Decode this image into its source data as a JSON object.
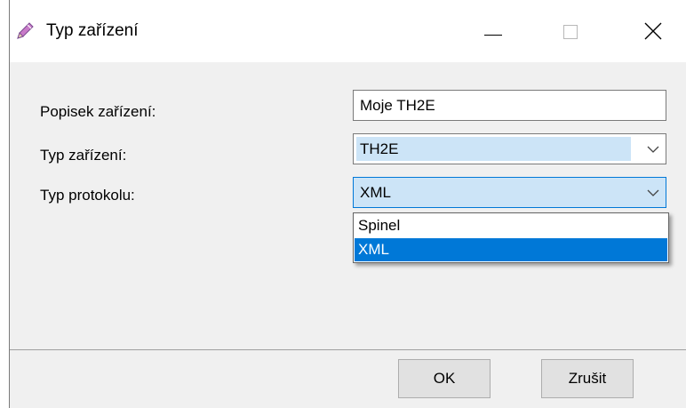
{
  "window": {
    "title": "Typ zařízení",
    "icon": "pencil-icon"
  },
  "form": {
    "description_label": "Popisek zařízení:",
    "description_value": "Moje TH2E",
    "device_type_label": "Typ zařízení:",
    "device_type_value": "TH2E",
    "protocol_label": "Typ protokolu:",
    "protocol_value": "XML"
  },
  "protocol_options": [
    "Spinel",
    "XML"
  ],
  "buttons": {
    "ok_label": "OK",
    "cancel_label": "Zrušit"
  },
  "colors": {
    "accent": "#0078d7",
    "selection_light": "#cce4f7"
  }
}
